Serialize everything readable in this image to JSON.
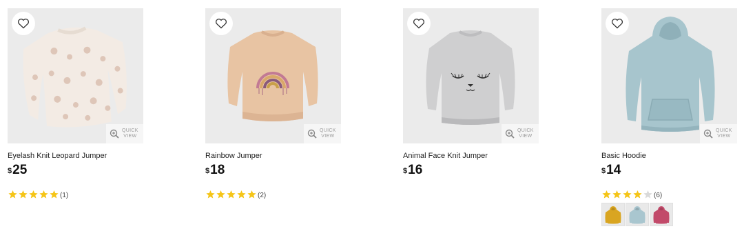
{
  "colors": {
    "star_filled": "#f5c518",
    "star_empty": "#d9d9d9",
    "image_bg": "#ebebeb"
  },
  "quick_view": {
    "line1": "QUICK",
    "line2": "VIEW"
  },
  "currency": "$",
  "products": [
    {
      "name": "Eyelash Knit Leopard Jumper",
      "price": "25",
      "rating": 5,
      "review_count": "(1)",
      "icon": "leopard-jumper"
    },
    {
      "name": "Rainbow Jumper",
      "price": "18",
      "rating": 5,
      "review_count": "(2)",
      "icon": "rainbow-jumper"
    },
    {
      "name": "Animal Face Knit Jumper",
      "price": "16",
      "icon": "animal-face-jumper"
    },
    {
      "name": "Basic Hoodie",
      "price": "14",
      "rating": 4,
      "review_count": "(6)",
      "icon": "basic-hoodie",
      "swatches": [
        {
          "name": "mustard",
          "color": "#d9a521"
        },
        {
          "name": "blue",
          "color": "#a9c6cf"
        },
        {
          "name": "pink",
          "color": "#c24a6a"
        }
      ]
    }
  ]
}
